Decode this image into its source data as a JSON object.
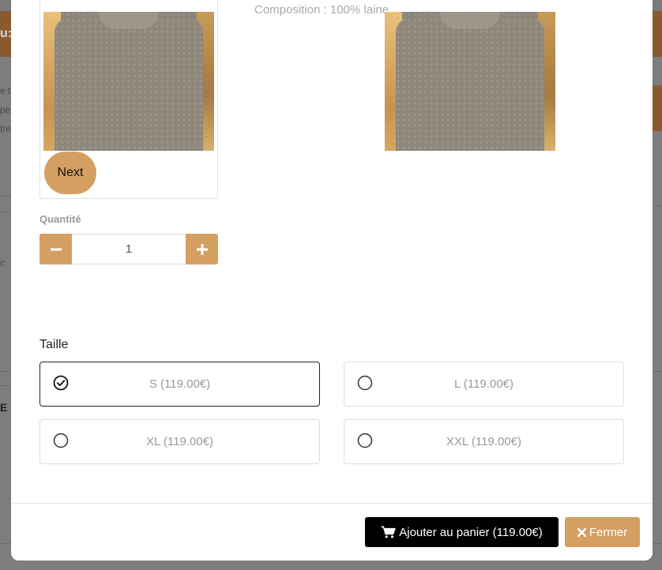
{
  "background": {
    "header_text": "u:",
    "snippets": [
      "e t",
      "pe",
      "tre",
      "c",
      "E"
    ]
  },
  "modal": {
    "composition": "Composition : 100% laine",
    "gallery": {
      "next_label": "Next",
      "image_alt": "Pull sans manches gris"
    },
    "quantity": {
      "label": "Quantité",
      "value": "1",
      "minus_icon": "minus-icon",
      "plus_icon": "plus-icon"
    },
    "size": {
      "label": "Taille",
      "options": [
        {
          "label": "S (119.00€)",
          "selected": true
        },
        {
          "label": "L (119.00€)",
          "selected": false
        },
        {
          "label": "XL (119.00€)",
          "selected": false
        },
        {
          "label": "XXL (119.00€)",
          "selected": false
        }
      ]
    },
    "footer": {
      "add_to_cart": "Ajouter au panier (119.00€)",
      "close": "Fermer",
      "cart_icon": "shopping-cart-icon",
      "close_icon": "times-icon"
    }
  },
  "colors": {
    "accent": "#d4a062",
    "primary_button": "#000000",
    "header_bg": "#8a5a2e"
  }
}
